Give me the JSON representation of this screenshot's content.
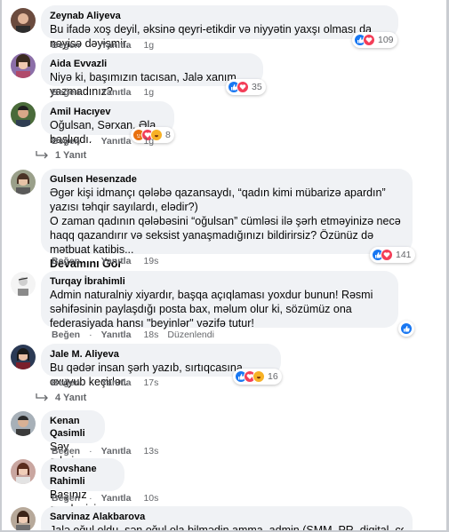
{
  "actions": {
    "like": "Beğen",
    "reply": "Yanıtla",
    "edited": "Düzenlendi"
  },
  "comments": [
    {
      "name": "Zeynab Aliyeva",
      "lines": [
        "Bu ifadə xoş deyil, əksinə qeyri-etikdir və niyyətin yaxşı olması da nəyisə dəyişmir."
      ],
      "time": "1g",
      "reactions": "109"
    },
    {
      "name": "Aida Evvazli",
      "lines": [
        "Niyə ki, başımızın tacısan, Jalə xanım, yazmadınız?"
      ],
      "time": "1g",
      "reactions": "35"
    },
    {
      "name": "Amil Hacıyev",
      "lines": [
        "Oğulsan, Sərxan. Əla başlıqdı."
      ],
      "time": "1g",
      "reactions": "8",
      "replies": "1 Yanıt"
    },
    {
      "name": "Gulsen Hesenzade",
      "lines": [
        "Əgər kişi idmançı qələbə qazansaydı, “qadın kimi mübarizə apardın” yazısı təhqir sayılardı, elədir?)",
        "O zaman qadının qələbəsini “oğulsan” cümləsi ilə şərh etməyinizə necə haqq qazandırır və seksist yanaşmadığınızı bildirirsiz? Özünüz də mətbuat katibis..."
      ],
      "see_more": "Devamını Gör",
      "time": "19s",
      "reactions": "141"
    },
    {
      "name": "Turqay İbrahimli",
      "lines": [
        "Admin naturalniy xiyardır, başqa açıqlaması yoxdur bunun! Rəsmi səhifəsinin paylaşdığı posta bax, məlum olur ki, sözümüz ona federasiyada hansı \"beyinlər\" vəzifə tutur!"
      ],
      "time": "18s"
    },
    {
      "name": "Jale M. Aliyeva",
      "lines": [
        "Bu qədər insan şərh yazıb, sırtıqcasına oxuyub keçirlər."
      ],
      "time": "17s",
      "reactions": "16",
      "replies": "4 Yanıt"
    },
    {
      "name": "Kenan Qasimli",
      "lines": [
        "Səy admin"
      ],
      "time": "13s"
    },
    {
      "name": "Rovshane Rahimli",
      "lines": [
        "Başınız qaçıb sizin"
      ],
      "time": "10s"
    },
    {
      "name": "Sarvinaz Alakbarova",
      "lines": [
        "Jalə oğul oldu, sən oğul ola bilmədin amma, admin (SMM, PR, digital, content"
      ]
    }
  ],
  "colors": {
    "like": "#1877f2",
    "love": "#f33e58",
    "haha": "#f7b125",
    "bubble": "#f0f2f5",
    "meta": "#65676b"
  }
}
